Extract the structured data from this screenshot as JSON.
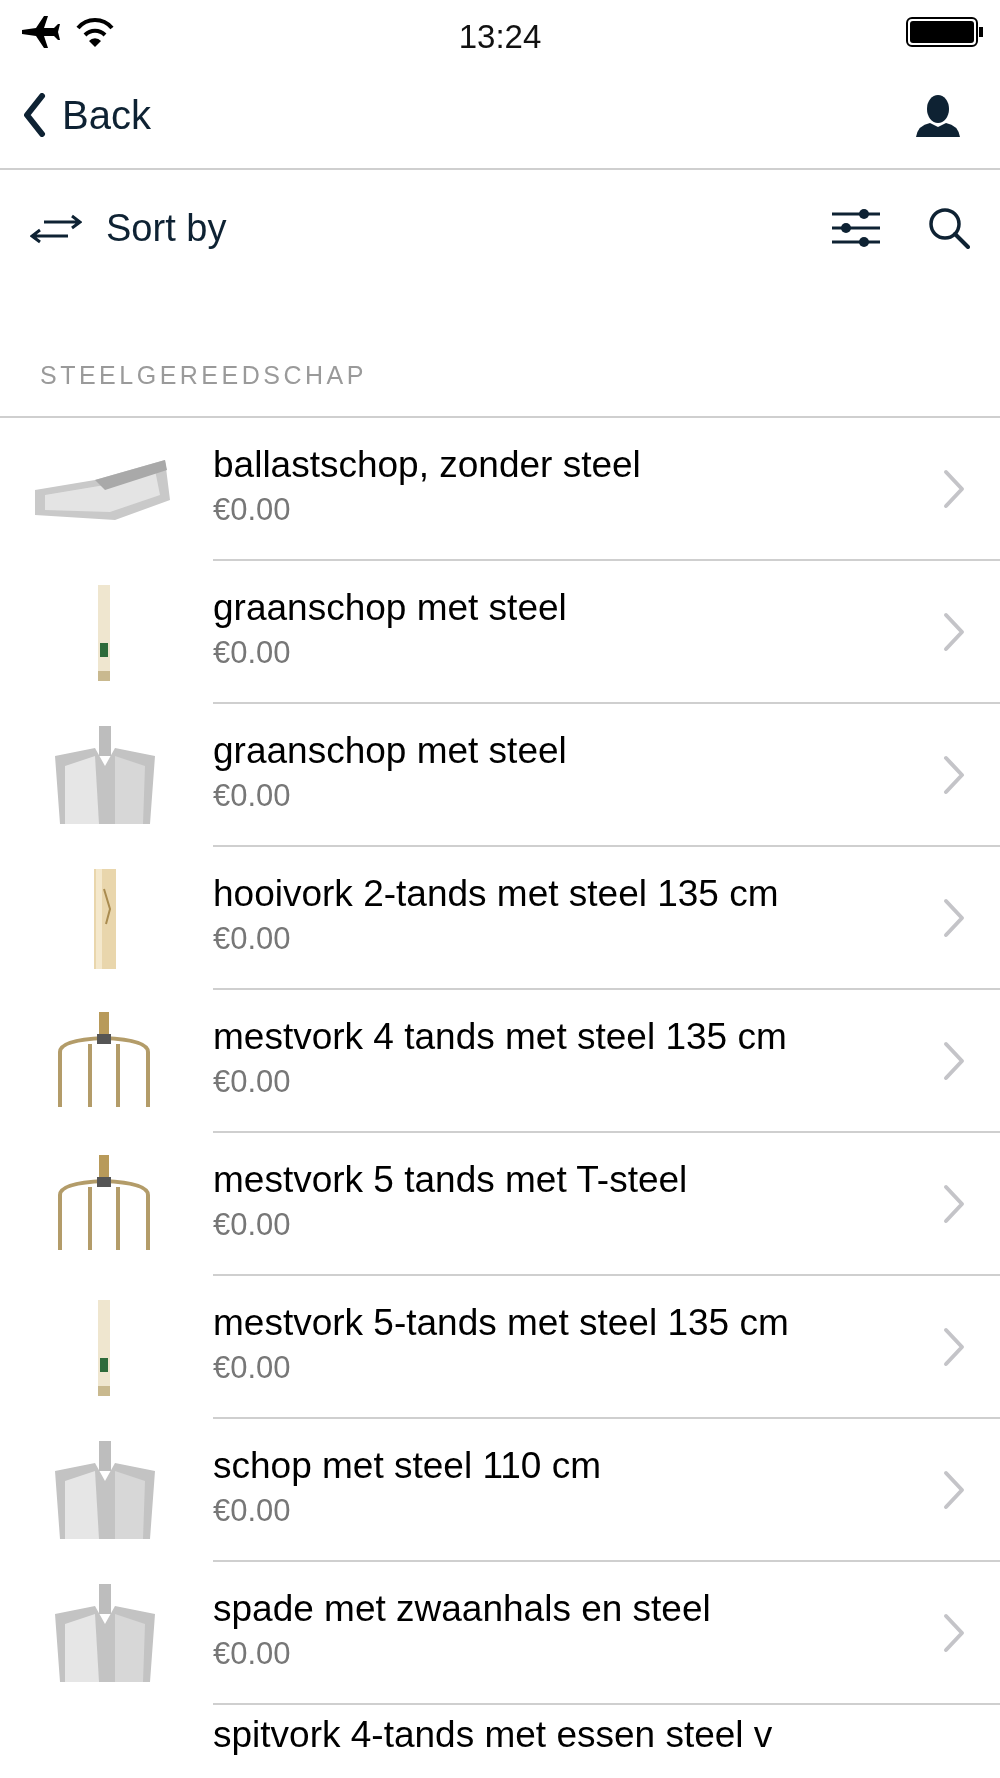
{
  "status_bar": {
    "time": "13:24"
  },
  "nav": {
    "back": "Back"
  },
  "toolbar": {
    "sort": "Sort by"
  },
  "section": {
    "title": "STEELGEREEDSCHAP"
  },
  "products": [
    {
      "name": "ballastschop, zonder steel",
      "price": "€0.00"
    },
    {
      "name": "graanschop met steel",
      "price": "€0.00"
    },
    {
      "name": "graanschop met steel",
      "price": "€0.00"
    },
    {
      "name": "hooivork 2-tands met steel 135 cm",
      "price": "€0.00"
    },
    {
      "name": "mestvork 4 tands met steel 135 cm",
      "price": "€0.00"
    },
    {
      "name": "mestvork 5 tands met T-steel",
      "price": "€0.00"
    },
    {
      "name": "mestvork 5-tands met steel 135 cm",
      "price": "€0.00"
    },
    {
      "name": "schop met steel 110 cm",
      "price": "€0.00"
    },
    {
      "name": "spade met zwaanhals en steel",
      "price": "€0.00"
    },
    {
      "name": "spitvork 4-tands met essen steel v"
    }
  ]
}
